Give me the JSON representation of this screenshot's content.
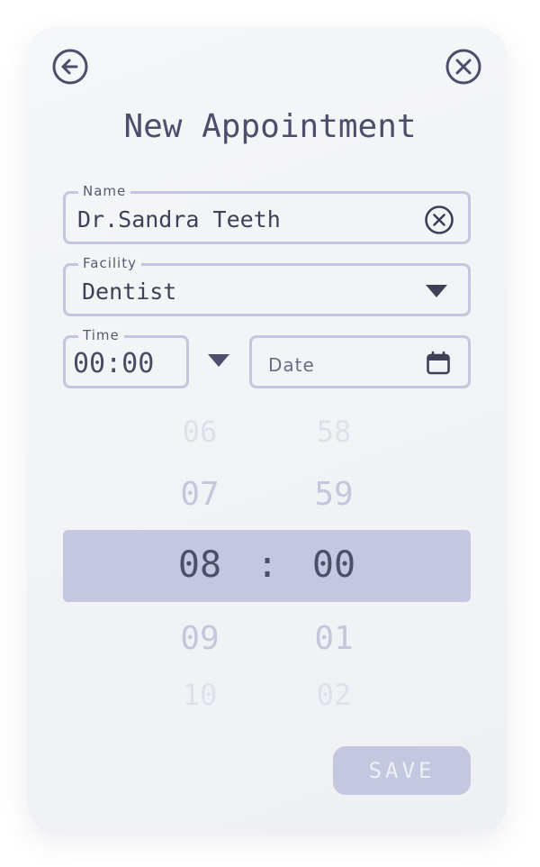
{
  "header": {
    "title": "New Appointment",
    "back_icon": "arrow-left-circle-icon",
    "close_icon": "close-circle-icon"
  },
  "form": {
    "name": {
      "label": "Name",
      "value": "Dr.Sandra Teeth",
      "clear_icon": "clear-circle-icon"
    },
    "facility": {
      "label": "Facility",
      "value": "Dentist",
      "dropdown_icon": "caret-down-icon"
    },
    "time": {
      "label": "Time",
      "value": "00:00",
      "dropdown_icon": "caret-down-icon"
    },
    "date": {
      "placeholder": "Date",
      "calendar_icon": "calendar-icon"
    }
  },
  "picker": {
    "hours": [
      "06",
      "07",
      "08",
      "09",
      "10"
    ],
    "minutes": [
      "58",
      "59",
      "00",
      "01",
      "02"
    ],
    "separator": ":",
    "selected_index": 2
  },
  "actions": {
    "save_label": "SAVE"
  },
  "colors": {
    "accent": "#c3c7df",
    "text": "#4d4e6c",
    "border": "#c3c6de"
  }
}
